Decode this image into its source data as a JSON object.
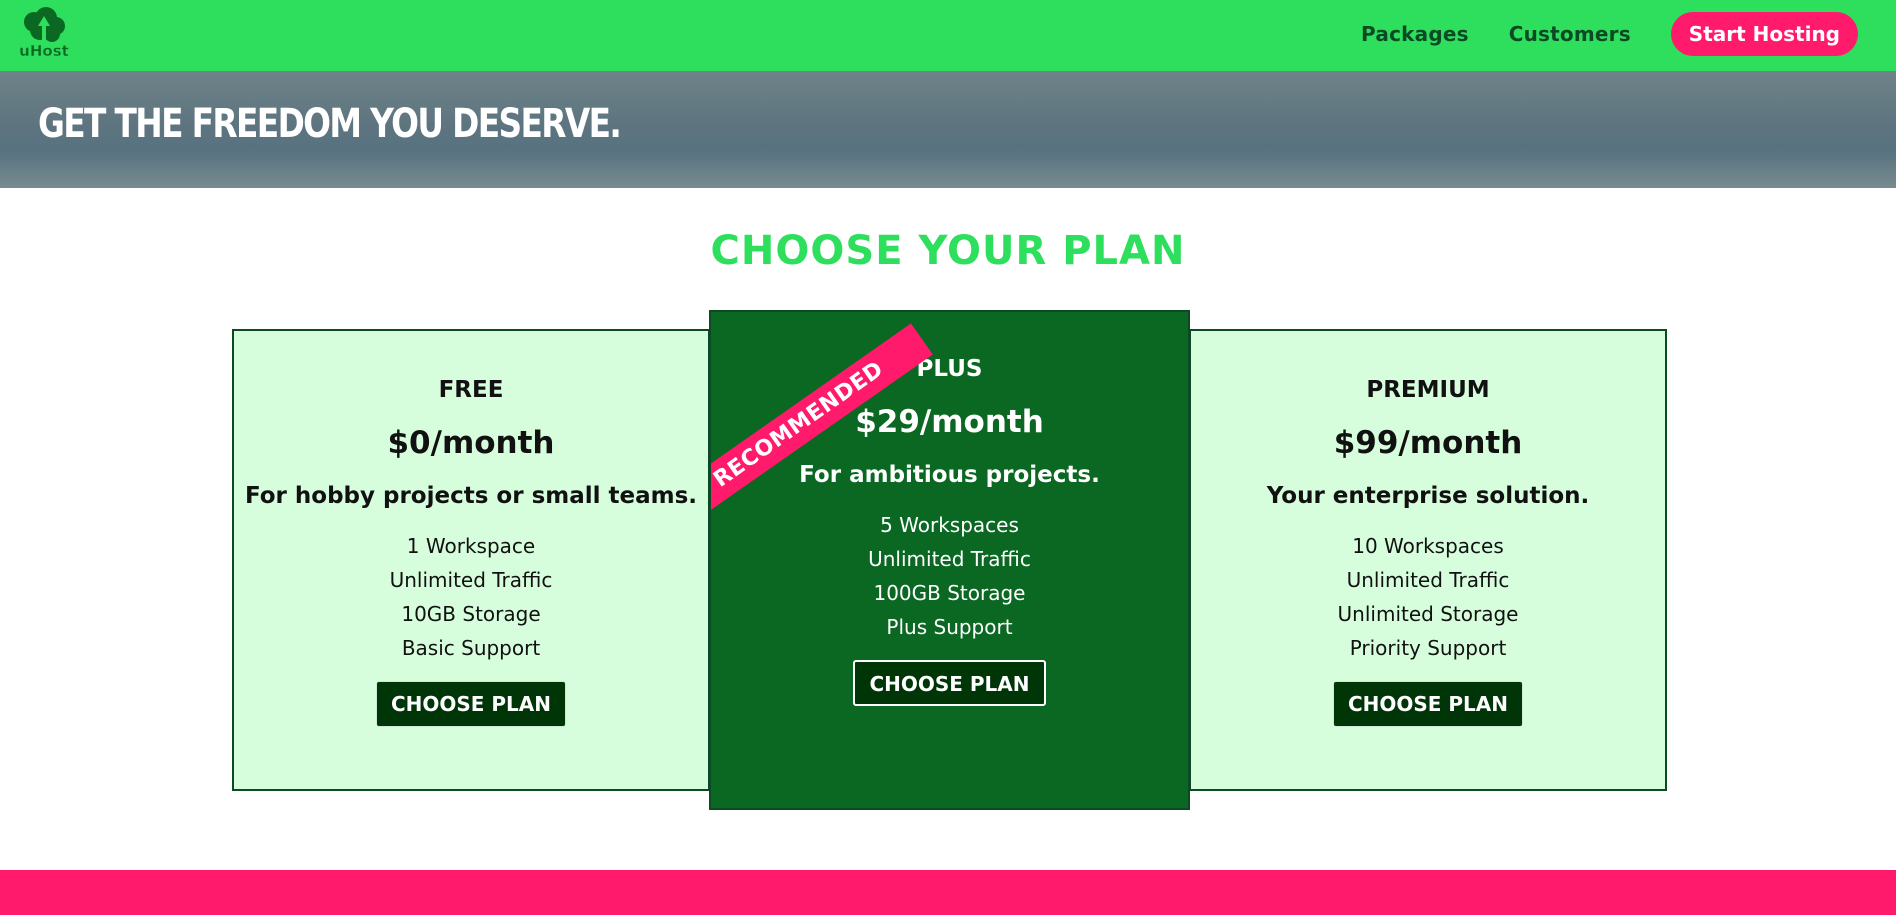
{
  "header": {
    "logo_text": "uHost",
    "nav": {
      "packages": "Packages",
      "customers": "Customers",
      "start_hosting": "Start Hosting"
    }
  },
  "hero": {
    "title": "Get the freedom you deserve."
  },
  "plans_section": {
    "title": "CHOOSE YOUR PLAN",
    "plans": [
      {
        "name": "FREE",
        "price": "$0/month",
        "tagline": "For hobby projects or small teams.",
        "features": [
          "1 Workspace",
          "Unlimited Traffic",
          "10GB Storage",
          "Basic Support"
        ],
        "button": "CHOOSE PLAN"
      },
      {
        "name": "PLUS",
        "price": "$29/month",
        "tagline": "For ambitious projects.",
        "features": [
          "5 Workspaces",
          "Unlimited Traffic",
          "100GB Storage",
          "Plus Support"
        ],
        "button": "CHOOSE PLAN",
        "badge": "RECOMMENDED"
      },
      {
        "name": "PREMIUM",
        "price": "$99/month",
        "tagline": "Your enterprise solution.",
        "features": [
          "10 Workspaces",
          "Unlimited Traffic",
          "Unlimited Storage",
          "Priority Support"
        ],
        "button": "CHOOSE PLAN"
      }
    ]
  },
  "colors": {
    "brand_green": "#2ddf5c",
    "dark_green": "#0a6822",
    "light_green": "#d6fedd",
    "accent_pink": "#ff1a6b",
    "button_dark": "#003508"
  }
}
